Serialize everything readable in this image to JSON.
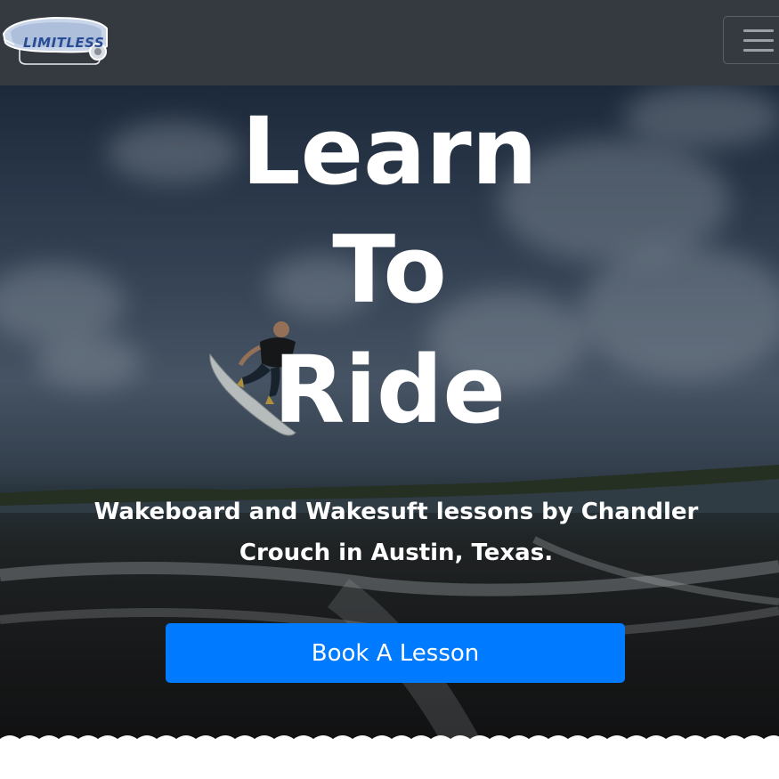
{
  "navbar": {
    "logo_text": "LIMITLESS",
    "menu_icon": "hamburger-icon"
  },
  "hero": {
    "headline_line1": "Learn",
    "headline_line2": "To",
    "headline_line3": "Ride",
    "subheading": "Wakeboard and Wakesuft lessons by Chandler Crouch in Austin, Texas.",
    "cta_label": "Book A Lesson"
  },
  "colors": {
    "navbar_bg": "#343a40",
    "cta_bg": "#007bff",
    "text": "#ffffff"
  }
}
